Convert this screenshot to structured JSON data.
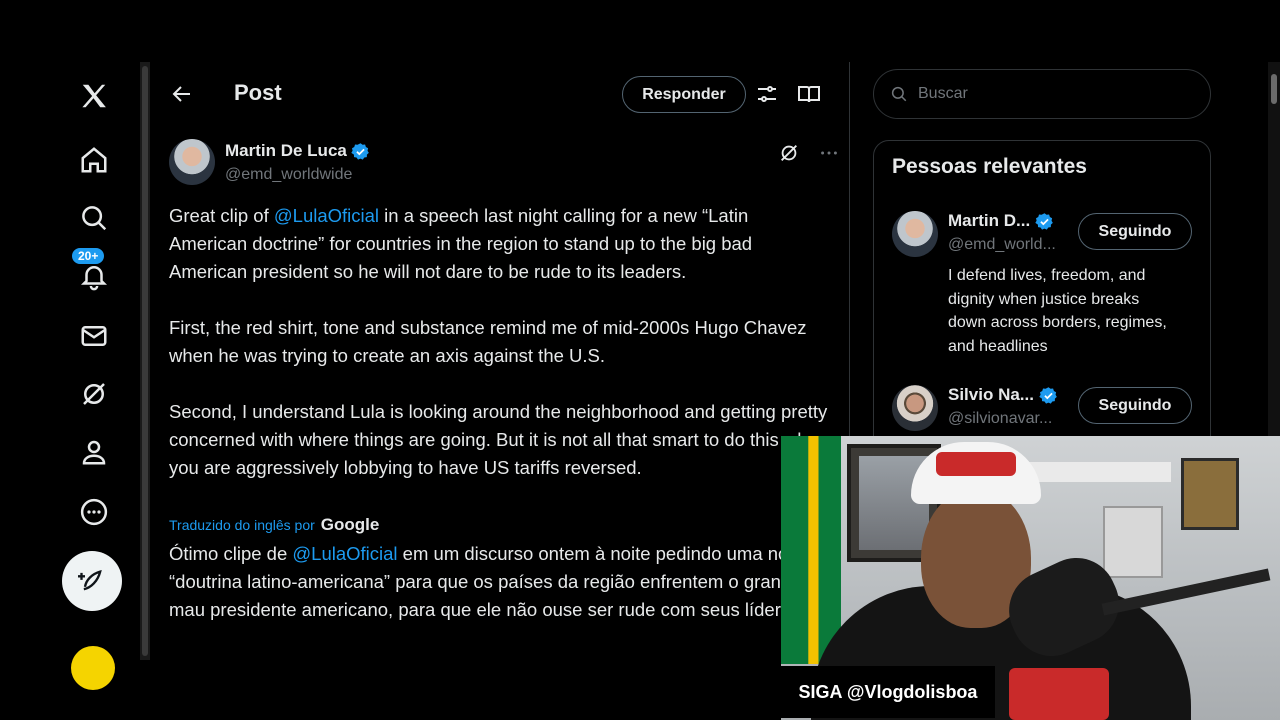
{
  "header": {
    "title": "Post",
    "reply_button": "Responder"
  },
  "nav": {
    "notifications_badge": "20+"
  },
  "post": {
    "author_name": "Martin De Luca",
    "author_handle": "@emd_worldwide",
    "paragraph1_a": "Great clip of ",
    "mention": "@LulaOficial",
    "paragraph1_b": " in a speech last night calling for a new “Latin American doctrine” for countries in the region to stand up to the big bad American president so he will not dare to be rude to its leaders.",
    "paragraph2": "First, the red shirt, tone and substance remind me of mid-2000s Hugo Chavez when he was trying to create an axis against the U.S.",
    "paragraph3": "Second, I understand Lula is looking around the neighborhood and getting pretty concerned with where things are going. But it is not all that smart to do this when you are aggressively lobbying to have US tariffs reversed.",
    "translated_label": "Traduzido do inglês por",
    "translator": "Google",
    "translation_a": "Ótimo clipe de ",
    "translation_mention": "@LulaOficial",
    "translation_b": " em um discurso ontem à noite pedindo uma nova “doutrina latino-americana” para que os países da região enfrentem o grande e mau presidente americano, para que ele não ouse ser rude com seus líderes."
  },
  "search": {
    "placeholder": "Buscar"
  },
  "relevant": {
    "title": "Pessoas relevantes",
    "people": [
      {
        "name": "Martin D...",
        "handle": "@emd_world...",
        "button": "Seguindo",
        "bio": "I defend lives, freedom, and dignity when justice breaks down across borders, regimes, and headlines"
      },
      {
        "name": "Silvio Na...",
        "handle": "@silvionavar...",
        "button": "Seguindo"
      }
    ]
  },
  "overlay": {
    "siga": "SIGA @Vlogdolisboa"
  },
  "colors": {
    "accent": "#1d9bf0",
    "background": "#000000",
    "text": "#e7e9ea",
    "muted": "#71767b"
  }
}
